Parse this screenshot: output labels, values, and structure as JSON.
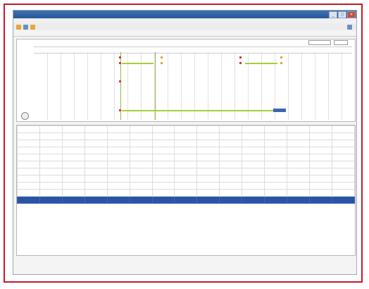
{
  "window": {
    "title": "",
    "controls": [
      "_",
      "□",
      "✕"
    ]
  },
  "menu": [],
  "toolbar": {
    "text": ""
  },
  "tabs": [],
  "gantt": {
    "header_left": [],
    "header_center": "",
    "header_right": "",
    "days": [],
    "row_labels": []
  },
  "table": {
    "columns": [],
    "rows": [
      {
        "name": "",
        "cells": [
          "",
          "",
          "",
          "",
          "",
          "",
          "",
          "",
          "",
          "",
          "",
          "",
          "",
          ""
        ]
      },
      {
        "name": "",
        "cells": [
          "",
          "",
          "",
          "",
          "",
          "",
          "",
          "",
          "",
          "",
          "",
          "",
          "",
          ""
        ]
      },
      {
        "name": "",
        "cells": [
          "",
          "",
          "",
          "",
          "",
          "",
          "",
          "",
          "",
          "",
          "",
          "",
          "",
          ""
        ]
      },
      {
        "name": "",
        "cells": [
          "",
          "",
          "",
          "",
          "",
          "",
          "",
          "",
          "",
          "",
          "",
          "",
          "",
          ""
        ]
      },
      {
        "name": "",
        "cells": [
          "",
          "",
          "",
          "",
          "",
          "",
          "",
          "",
          "",
          "",
          "",
          "",
          "",
          ""
        ]
      },
      {
        "name": "",
        "cells": [
          "",
          "",
          "",
          "",
          "",
          "",
          "",
          "",
          "",
          "",
          "",
          "",
          "",
          ""
        ]
      },
      {
        "name": "",
        "cells": [
          "",
          "",
          "",
          "",
          "",
          "",
          "",
          "",
          "",
          "",
          "",
          "",
          "",
          ""
        ]
      },
      {
        "name": "",
        "cells": [
          "",
          "",
          "",
          "",
          "",
          "",
          "",
          "",
          "",
          "",
          "",
          "",
          "",
          ""
        ]
      },
      {
        "name": "",
        "cells": [
          "",
          "",
          "",
          "",
          "",
          "",
          "",
          "",
          "",
          "",
          "",
          "",
          "",
          ""
        ]
      },
      {
        "name": "",
        "cells": [
          "",
          "",
          "",
          "",
          "",
          "",
          "",
          "",
          "",
          "",
          "",
          "",
          "",
          ""
        ]
      },
      {
        "name": "",
        "cells": [
          "",
          "",
          "",
          "",
          "",
          "",
          "",
          "",
          "",
          "",
          "",
          "",
          "",
          ""
        ]
      }
    ],
    "selected_index": 10
  },
  "footer": []
}
